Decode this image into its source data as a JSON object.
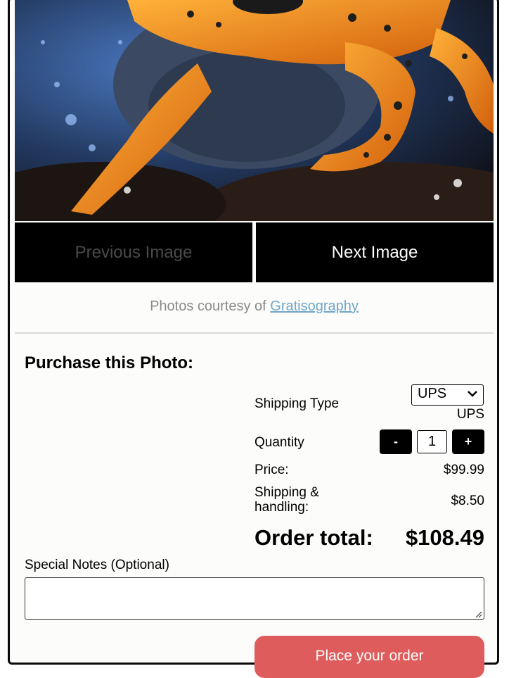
{
  "gallery": {
    "prev_label": "Previous Image",
    "next_label": "Next Image",
    "credit_text": "Photos courtesy of ",
    "credit_link": "Gratisography"
  },
  "purchase": {
    "heading": "Purchase this Photo:",
    "shipping_type_label": "Shipping Type",
    "shipping_type_selected": "UPS",
    "shipping_type_display": "UPS",
    "quantity_label": "Quantity",
    "quantity_minus": "-",
    "quantity_value": "1",
    "quantity_plus": "+",
    "price_label": "Price:",
    "price_value": "$99.99",
    "shipping_label": "Shipping & handling:",
    "shipping_value": "$8.50",
    "total_label": "Order total:",
    "total_value": "$108.49",
    "notes_label": "Special Notes (Optional)",
    "order_button": "Place your order"
  },
  "colors": {
    "nav_bg": "#000000",
    "link": "#6fa6c6",
    "order_button": "#de5c5c"
  }
}
